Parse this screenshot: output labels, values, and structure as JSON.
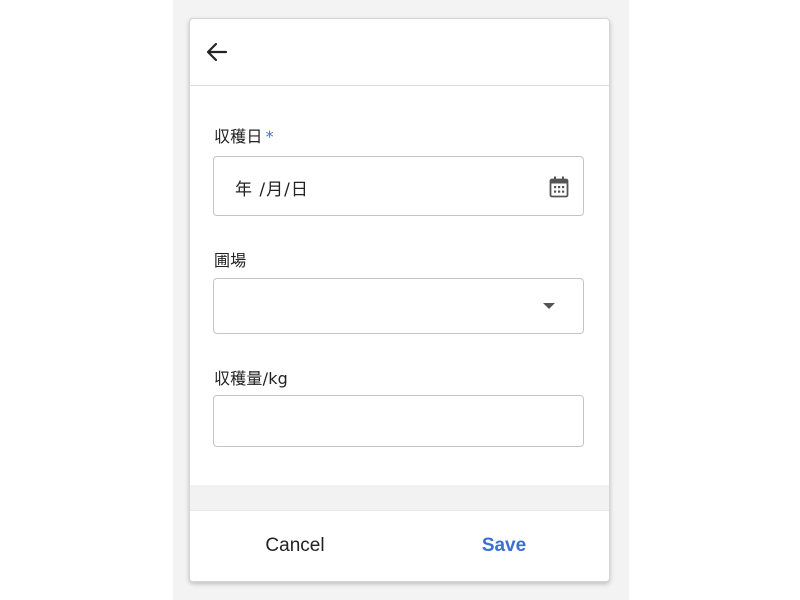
{
  "header": {
    "back_icon": "arrow-left-icon"
  },
  "form": {
    "harvest_date": {
      "label": "収穫日",
      "required_marker": "*",
      "value": "年 /月/日",
      "icon": "calendar-icon"
    },
    "field": {
      "label": "圃場",
      "selected_value": "",
      "icon": "dropdown-caret-icon"
    },
    "harvest_amount": {
      "label": "収穫量/kg",
      "value": ""
    }
  },
  "footer": {
    "cancel_label": "Cancel",
    "save_label": "Save"
  },
  "colors": {
    "accent": "#3b6fd1",
    "text": "#222222",
    "border": "#c4c4c4",
    "backdrop": "#f3f3f4"
  }
}
